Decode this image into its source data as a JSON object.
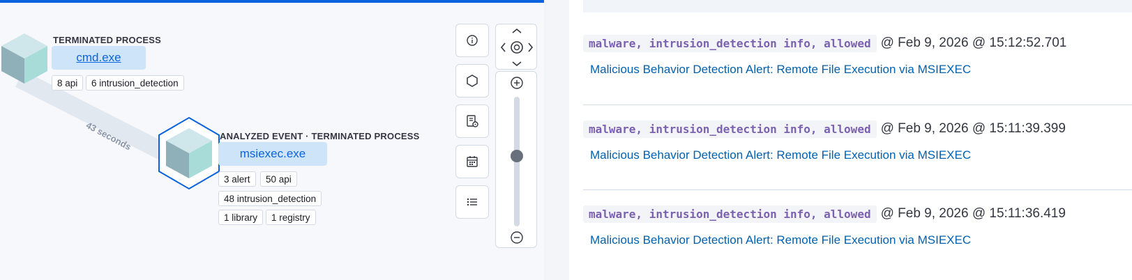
{
  "graph": {
    "edge_label": "43 seconds",
    "nodes": [
      {
        "title": "TERMINATED PROCESS",
        "name": "cmd.exe",
        "pills": [
          "8 api",
          "6 intrusion_detection"
        ]
      },
      {
        "title": "ANALYZED EVENT · TERMINATED PROCESS",
        "name": "msiexec.exe",
        "pills": [
          "3 alert",
          "50 api",
          "48 intrusion_detection",
          "1 library",
          "1 registry"
        ]
      }
    ],
    "toolbar": [
      {
        "icon": "info-icon"
      },
      {
        "icon": "hexagon-icon"
      },
      {
        "icon": "schema-settings-icon"
      },
      {
        "icon": "calendar-icon"
      },
      {
        "icon": "list-icon"
      }
    ],
    "zoom_level": 0.45
  },
  "events": [
    {
      "tags": "malware, intrusion_detection info, allowed",
      "timestamp": "@ Feb 9, 2026 @ 15:12:52.701",
      "title": "Malicious Behavior Detection Alert: Remote File Execution via MSIEXEC"
    },
    {
      "tags": "malware, intrusion_detection info, allowed",
      "timestamp": "@ Feb 9, 2026 @ 15:11:39.399",
      "title": "Malicious Behavior Detection Alert: Remote File Execution via MSIEXEC"
    },
    {
      "tags": "malware, intrusion_detection info, allowed",
      "timestamp": "@ Feb 9, 2026 @ 15:11:36.419",
      "title": "Malicious Behavior Detection Alert: Remote File Execution via MSIEXEC"
    }
  ],
  "colors": {
    "accent": "#0b64dd",
    "node_bg": "#cde4f9",
    "tag_text": "#7b61b0",
    "link": "#0061b0"
  }
}
